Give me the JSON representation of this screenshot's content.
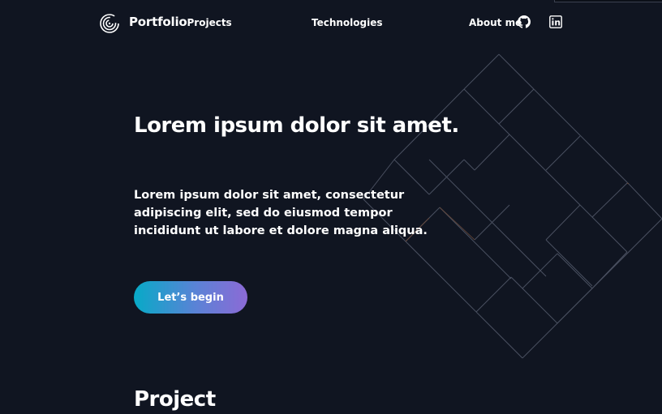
{
  "nav": {
    "brand_main": "Portfolio",
    "brand_sub": "Projects",
    "technologies": "Technologies",
    "about": "About me",
    "icons": [
      "logo-spiral-icon",
      "github-icon",
      "linkedin-icon"
    ]
  },
  "hero": {
    "title": "Lorem ipsum dolor sit amet.",
    "description": "Lorem ipsum dolor sit amet, consectetur adipiscing elit, sed do eiusmod tempor incididunt ut labore et dolore magna aliqua.",
    "cta_label": "Let’s begin"
  },
  "section": {
    "title": "Project"
  },
  "colors": {
    "background": "#101521",
    "text": "#ffffff",
    "gradient_start": "#07aac7",
    "gradient_end": "#8c6ad6",
    "deco_line": "#4a5060",
    "deco_accent": "#6b4a3a"
  }
}
